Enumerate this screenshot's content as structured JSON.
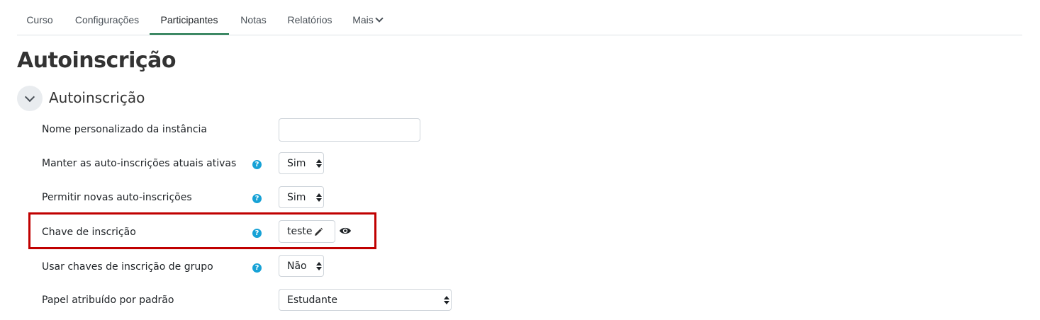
{
  "nav": {
    "tabs": [
      {
        "label": "Curso"
      },
      {
        "label": "Configurações"
      },
      {
        "label": "Participantes",
        "active": true
      },
      {
        "label": "Notas"
      },
      {
        "label": "Relatórios"
      },
      {
        "label": "Mais"
      }
    ]
  },
  "page": {
    "title": "Autoinscrição"
  },
  "section": {
    "title": "Autoinscrição",
    "icon": "chevron-down-icon"
  },
  "form": {
    "instance_name": {
      "label": "Nome personalizado da instância",
      "value": ""
    },
    "keep_current": {
      "label": "Manter as auto-inscrições atuais ativas",
      "value": "Sim"
    },
    "allow_new": {
      "label": "Permitir novas auto-inscrições",
      "value": "Sim"
    },
    "enrolment_key": {
      "label": "Chave de inscrição",
      "value": "teste"
    },
    "group_keys": {
      "label": "Usar chaves de inscrição de grupo",
      "value": "Não"
    },
    "default_role": {
      "label": "Papel atribuído por padrão",
      "value": "Estudante"
    },
    "help_symbol": "?"
  },
  "colors": {
    "accent": "#0f6e3f",
    "help": "#17a2d6",
    "highlight": "#c00000"
  }
}
